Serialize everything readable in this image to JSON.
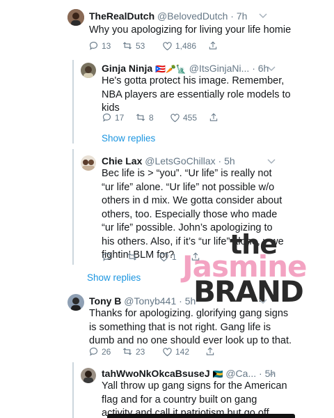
{
  "tweets": [
    {
      "name": "TheRealDutch",
      "handle": "@BelovedDutch",
      "dot": "·",
      "time": "7h",
      "lines": [
        "Why you apologizing for living your life homie"
      ],
      "replies": "13",
      "retweets": "53",
      "likes": "1,486"
    },
    {
      "name": "Ginja Ninja",
      "flags": "🇵🇷🥕🗽",
      "handle": "@ItsGinjaNi...",
      "dot": "·",
      "time": "6h",
      "lines": [
        "He's gotta protect his image. Remember,",
        "NBA players are essentially role models to",
        "kids"
      ],
      "replies": "17",
      "retweets": "8",
      "likes": "455",
      "show_replies": "Show replies"
    },
    {
      "name": "Chie Lax",
      "handle": "@LetsGoChillax",
      "dot": "·",
      "time": "5h",
      "lines": [
        "Bec life is > “you”. “Ur life” is really not",
        "“ur life” alone. “Ur life” not possible w/o",
        "others in d mix. We gotta consider about",
        "others, too. Especially those who made",
        "“ur life” possible.  John’s apologizing to",
        "his others. Also, if it’s “ur life” alone, y we",
        "fightin’ BLM for?"
      ],
      "replies": "",
      "retweets": "",
      "likes": "1",
      "show_replies": "Show replies"
    },
    {
      "name": "Tony B",
      "handle": "@Tonyb441",
      "dot": "·",
      "time": "5h",
      "lines": [
        "Thanks for apologizing. glorifying gang signs",
        "is something that is not right. Gang life is",
        "dumb and no one should ever look up to that."
      ],
      "replies": "26",
      "retweets": "23",
      "likes": "142"
    },
    {
      "name": "tahWwoNkOkcaBsuseJ",
      "flags": "🇧🇸",
      "handle": "@Ca...",
      "dot": "·",
      "time": "5h",
      "lines": [
        "Yall throw up gang signs for the American",
        "flag and for a country built on gang",
        "activity and call it patriotism but go off"
      ]
    }
  ],
  "watermark": {
    "line1": "the",
    "line2": "Jasmine",
    "line3": "BRAND"
  },
  "colors": {
    "link": "#1b95e0",
    "secondary_text": "#657786",
    "thread_line": "#ccd6dd",
    "watermark_pink": "#f3a3c2"
  }
}
